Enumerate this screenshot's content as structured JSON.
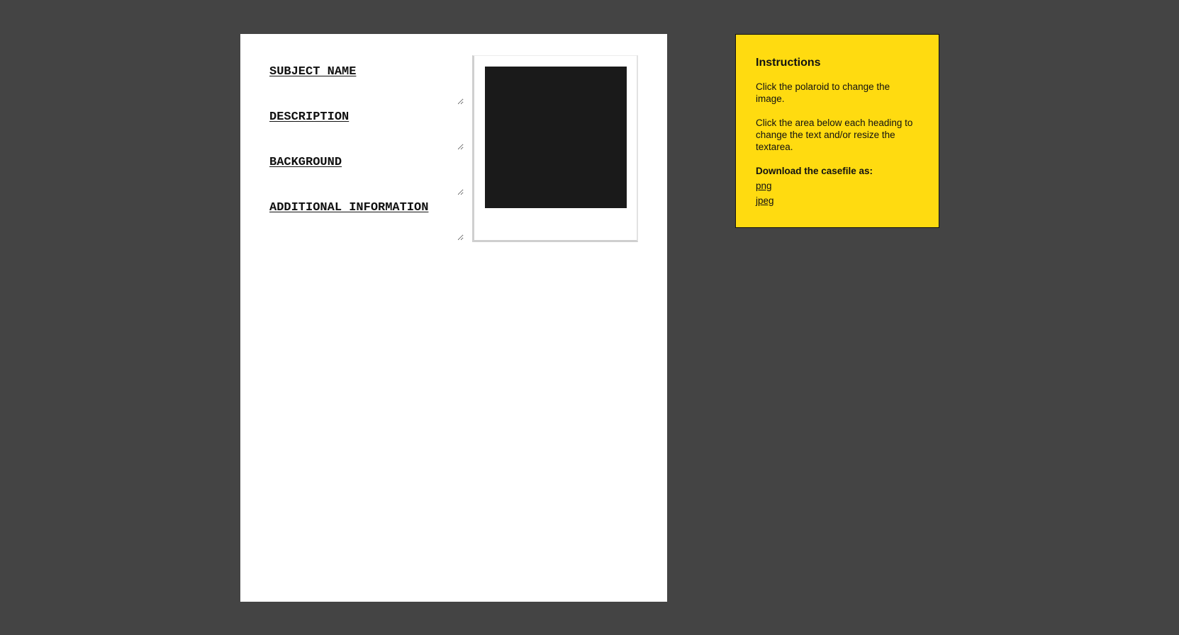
{
  "casefile": {
    "sections": [
      {
        "heading": "SUBJECT NAME",
        "text": ""
      },
      {
        "heading": "DESCRIPTION",
        "text": ""
      },
      {
        "heading": "BACKGROUND",
        "text": ""
      },
      {
        "heading": "ADDITIONAL INFORMATION",
        "text": ""
      }
    ],
    "photo_color": "#1a1a1a"
  },
  "instructions": {
    "title": "Instructions",
    "paragraphs": [
      "Click the polaroid to change the image.",
      "Click the area below each heading to change the text and/or resize the textarea."
    ],
    "download_label": "Download the casefile as:",
    "downloads": [
      "png",
      "jpeg"
    ],
    "accent_color": "#ffdb10"
  },
  "colors": {
    "background": "#444444",
    "paper": "#ffffff"
  }
}
